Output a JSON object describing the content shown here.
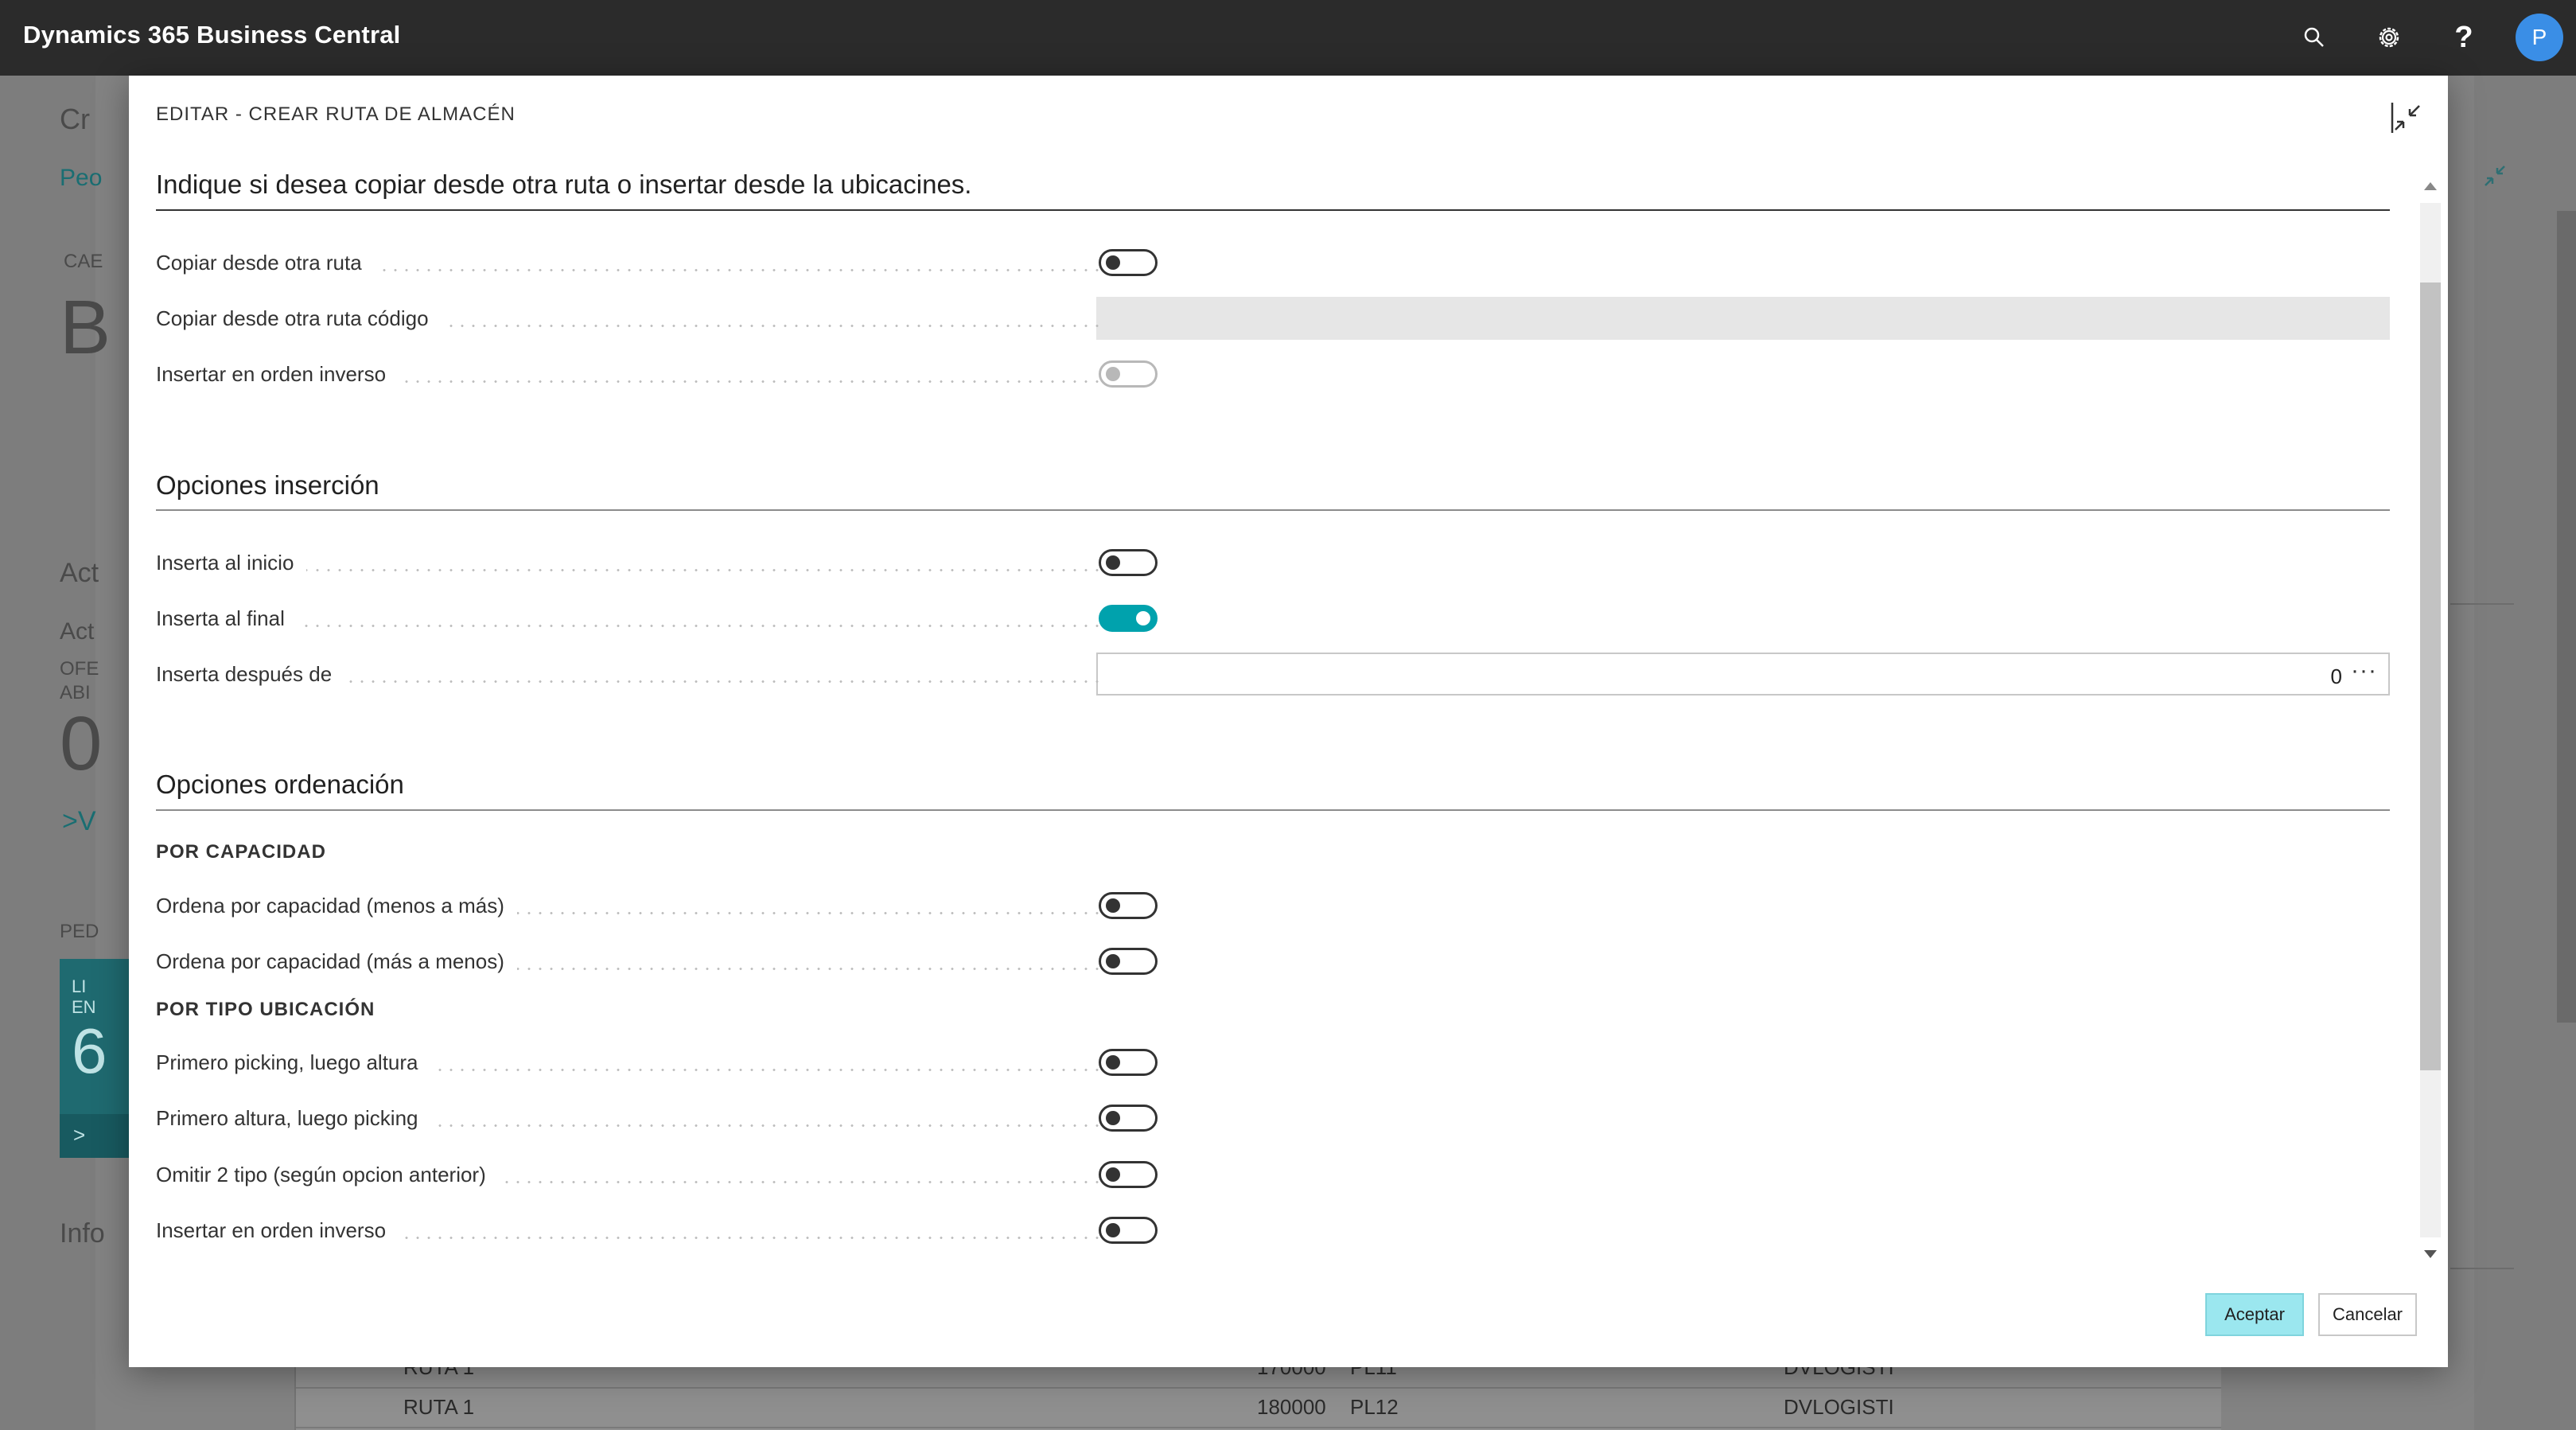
{
  "app": {
    "title": "Dynamics 365 Business Central",
    "avatar_initial": "P",
    "accent_color": "#00a2ad"
  },
  "background_page": {
    "fragments": [
      "Cr",
      "Peo",
      "CAE",
      "B",
      "Act",
      "Act",
      "OFE",
      "ABI",
      "0",
      ">V",
      "PED",
      "LI",
      "EN",
      "6",
      ">",
      "Info"
    ],
    "rows": [
      {
        "ruta": "RUTA 1",
        "numero": "170000",
        "ubicacion": "PL11",
        "usuario": "DVLOGISTI"
      },
      {
        "ruta": "RUTA 1",
        "numero": "180000",
        "ubicacion": "PL12",
        "usuario": "DVLOGISTI"
      }
    ]
  },
  "dialog": {
    "caption": "EDITAR - CREAR RUTA DE ALMACÉN",
    "sections": {
      "copy": {
        "title": "Indique si desea copiar desde otra ruta o insertar desde la ubicacines.",
        "copiar_desde_otra_ruta": {
          "label": "Copiar desde otra ruta",
          "on": false
        },
        "copiar_desde_otra_ruta_codigo": {
          "label": "Copiar desde otra ruta código",
          "value": ""
        },
        "insertar_orden_inverso": {
          "label": "Insertar en orden inverso",
          "on": false,
          "disabled": true
        }
      },
      "insercion": {
        "title": "Opciones inserción",
        "inserta_al_inicio": {
          "label": "Inserta al inicio",
          "on": false
        },
        "inserta_al_final": {
          "label": "Inserta al final",
          "on": true
        },
        "inserta_despues_de": {
          "label": "Inserta después de",
          "value": "0",
          "lookup": "···"
        }
      },
      "ordenacion": {
        "title": "Opciones ordenación",
        "por_capacidad": {
          "title": "POR CAPACIDAD",
          "menos_a_mas": {
            "label": "Ordena por capacidad (menos a más)",
            "on": false
          },
          "mas_a_menos": {
            "label": "Ordena por capacidad (más a menos)",
            "on": false
          }
        },
        "por_tipo": {
          "title": "POR TIPO UBICACIÓN",
          "picking_altura": {
            "label": "Primero picking, luego altura",
            "on": false
          },
          "altura_picking": {
            "label": "Primero altura, luego picking",
            "on": false
          },
          "omitir_2_tipo": {
            "label": "Omitir 2 tipo (según opcion anterior)",
            "on": false
          },
          "orden_inverso": {
            "label": "Insertar en orden inverso",
            "on": false
          }
        }
      }
    },
    "buttons": {
      "ok": "Aceptar",
      "cancel": "Cancelar"
    }
  }
}
